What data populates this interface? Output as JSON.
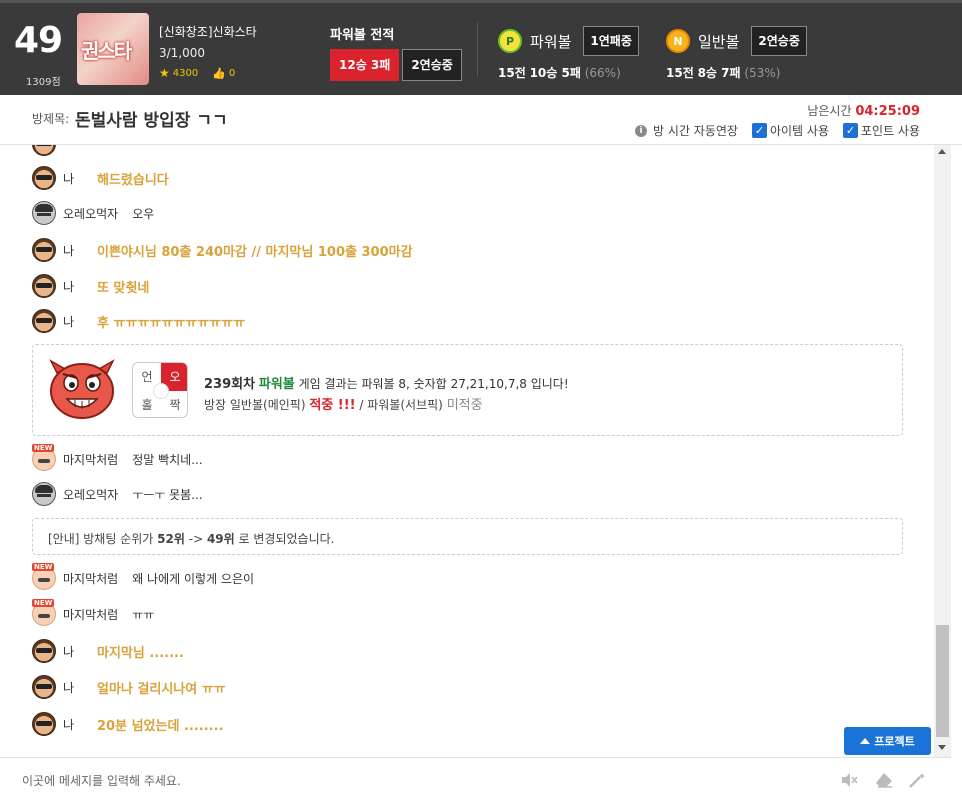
{
  "header": {
    "rank": "49",
    "score": "1309점",
    "thumb_text": "권스타",
    "host_name": "[신화창조]신화스타",
    "member_count": "3/1,000",
    "stars": "4300",
    "likes": "0",
    "record_title": "파워볼 전적",
    "record_badges": [
      "12승 3패",
      "2연승중"
    ],
    "games": [
      {
        "coin": "P",
        "name": "파워볼",
        "badge": "1연패중",
        "stats_total": "15전",
        "stats_wl": "10승 5패",
        "stats_pct": "(66%)"
      },
      {
        "coin": "N",
        "name": "일반볼",
        "badge": "2연승중",
        "stats_total": "15전",
        "stats_wl": "8승 7패",
        "stats_pct": "(53%)"
      }
    ]
  },
  "room": {
    "label": "방제목:",
    "title": "돈벌사람 방입장 ㄱㄱ",
    "remain_label": "남은시간",
    "remain_time": "04:25:09",
    "auto_extend": "방 시간 자동연장",
    "item_use": "아이템 사용",
    "point_use": "포인트 사용"
  },
  "messages": [
    {
      "nick": "나",
      "text": "해드렸습니다",
      "type": "me"
    },
    {
      "nick": "오레오먹자",
      "text": "오우",
      "type": "ore"
    },
    {
      "nick": "나",
      "text": "이쁜야시님 80출 240마감 // 마지막님 100출 300마감",
      "type": "me"
    },
    {
      "nick": "나",
      "text": "또 맞췻네",
      "type": "me"
    },
    {
      "nick": "나",
      "text": "후 ㅠㅠㅠㅠㅠㅠㅠㅠㅠㅠㅠ",
      "type": "me"
    },
    {
      "nick": "마지막처럼",
      "text": "정말 빡치네...",
      "type": "new"
    },
    {
      "nick": "오레오먹자",
      "text": "ㅜㅡㅜ 못봄...",
      "type": "ore"
    },
    {
      "nick": "마지막처럼",
      "text": "왜 나에게 이렇게 으은이",
      "type": "new"
    },
    {
      "nick": "마지막처럼",
      "text": "ㅠㅠ",
      "type": "new"
    },
    {
      "nick": "나",
      "text": "마지막님 .......",
      "type": "me"
    },
    {
      "nick": "나",
      "text": "얼마나 걸리시나여 ㅠㅠ",
      "type": "me"
    },
    {
      "nick": "나",
      "text": "20분 넘었는데 ........",
      "type": "me"
    }
  ],
  "result": {
    "grid": [
      "언",
      "오",
      "홀",
      "짝"
    ],
    "round": "239회차",
    "game": "파워볼",
    "line1_rest": "게임 결과는 파워볼 8, 숫자합 27,21,10,7,8 입니다!",
    "line2_prefix": "방장 일반볼(메인픽)",
    "hit": "적중 !!!",
    "line2_mid": "/ 파워볼(서브픽)",
    "miss": "미적중"
  },
  "notice": {
    "prefix": "[안내] 방채팅 순위가",
    "from": "52위",
    "arrow": "->",
    "to": "49위",
    "suffix": "로 변경되었습니다."
  },
  "project_button": "프로젝트",
  "input": {
    "placeholder": "이곳에 메세지를 입력해 주세요."
  },
  "colors": {
    "accent_red": "#d9232d",
    "me_text": "#d9a23a",
    "powerball_green": "#1e8a3a",
    "project_blue": "#1a73d9"
  }
}
